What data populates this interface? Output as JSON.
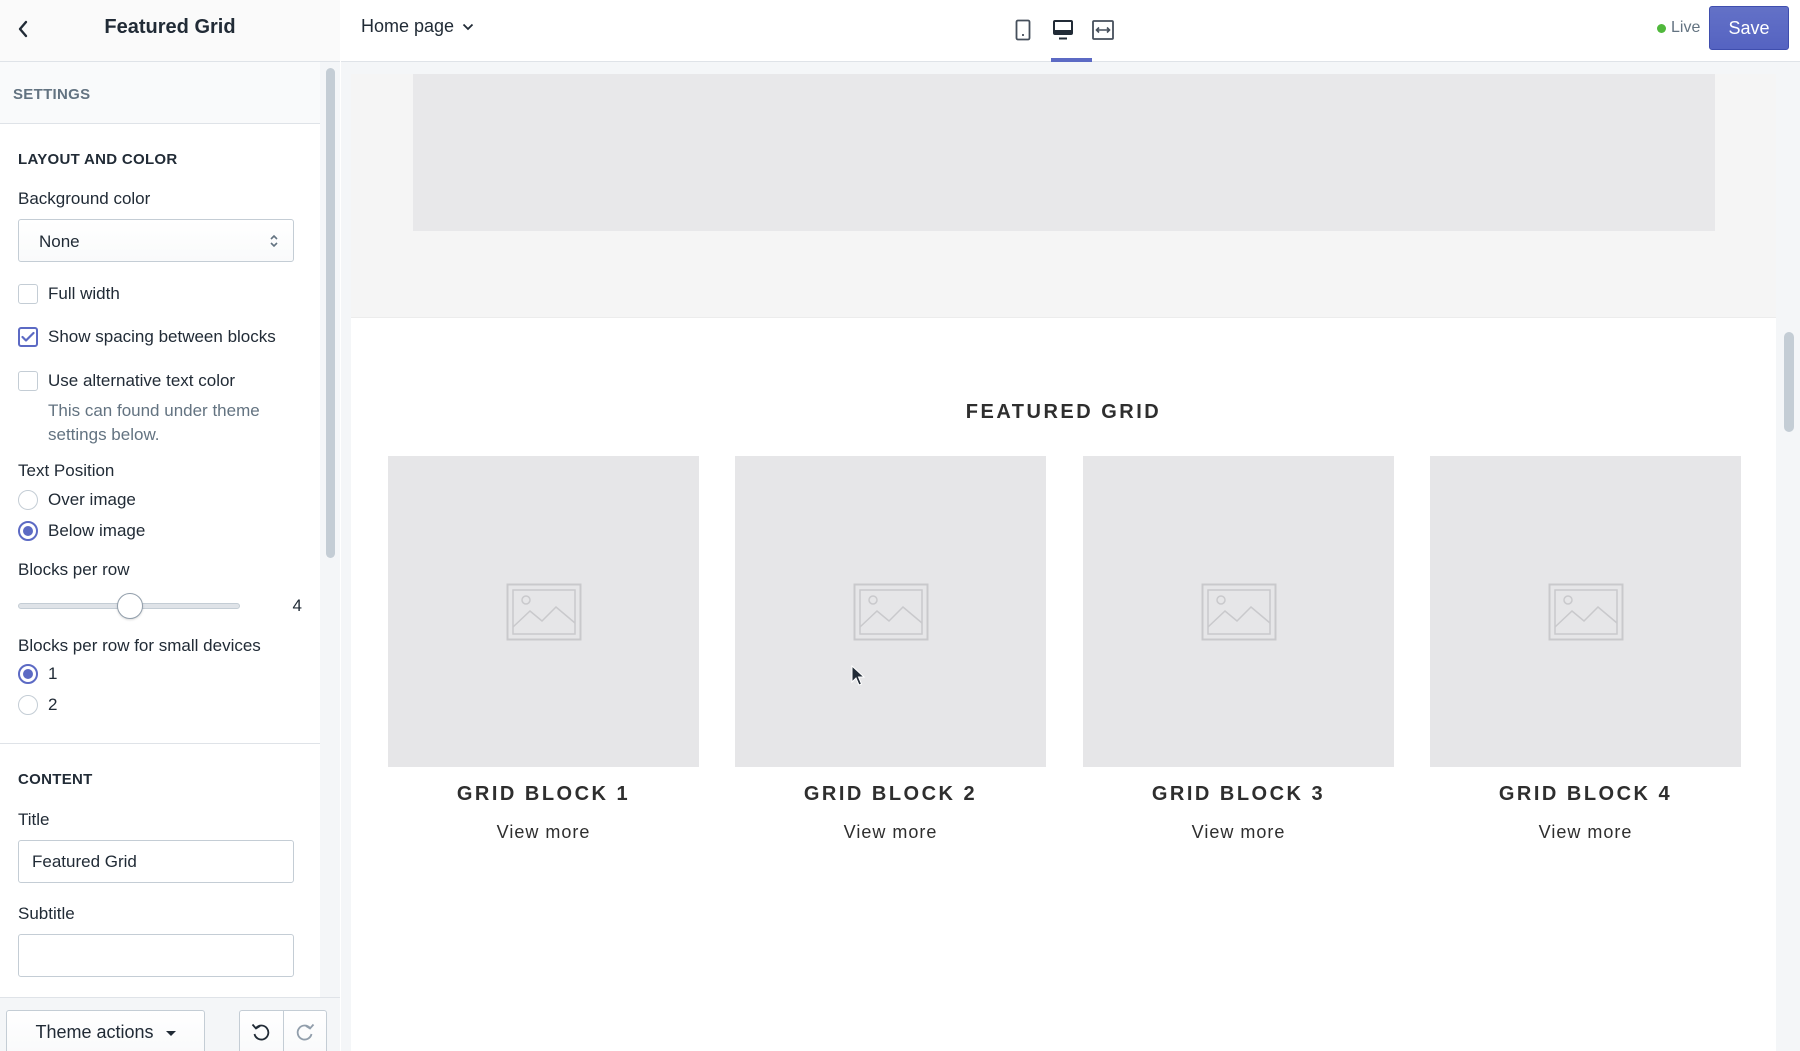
{
  "sidebar": {
    "title": "Featured Grid",
    "settings_label": "SETTINGS",
    "layout": {
      "heading": "LAYOUT AND COLOR",
      "background_label": "Background color",
      "background_value": "None",
      "full_width_label": "Full width",
      "full_width_checked": false,
      "spacing_label": "Show spacing between blocks",
      "spacing_checked": true,
      "alt_text_label": "Use alternative text color",
      "alt_text_checked": false,
      "alt_text_help": "This can found under theme settings below.",
      "text_position_label": "Text Position",
      "text_position_options": [
        "Over image",
        "Below image"
      ],
      "text_position_selected": "Below image",
      "blocks_per_row_label": "Blocks per row",
      "blocks_per_row_value": "4",
      "blocks_small_label": "Blocks per row for small devices",
      "blocks_small_options": [
        "1",
        "2"
      ],
      "blocks_small_selected": "1"
    },
    "content": {
      "heading": "CONTENT",
      "title_label": "Title",
      "title_value": "Featured Grid",
      "subtitle_label": "Subtitle",
      "subtitle_value": ""
    },
    "footer": {
      "theme_actions_label": "Theme actions"
    }
  },
  "topbar": {
    "page_label": "Home page",
    "view_icons": [
      "mobile-view-icon",
      "desktop-view-icon",
      "full-width-view-icon"
    ],
    "active_view": "desktop",
    "live_label": "Live",
    "save_label": "Save"
  },
  "preview": {
    "section_title": "FEATURED GRID",
    "blocks": [
      {
        "title": "GRID BLOCK 1",
        "link": "View more"
      },
      {
        "title": "GRID BLOCK 2",
        "link": "View more"
      },
      {
        "title": "GRID BLOCK 3",
        "link": "View more"
      },
      {
        "title": "GRID BLOCK 4",
        "link": "View more"
      }
    ]
  },
  "colors": {
    "accent": "#5c6ac4",
    "live": "#50b83c",
    "border": "#dfe3e8",
    "placeholder": "#e6e6e8"
  }
}
